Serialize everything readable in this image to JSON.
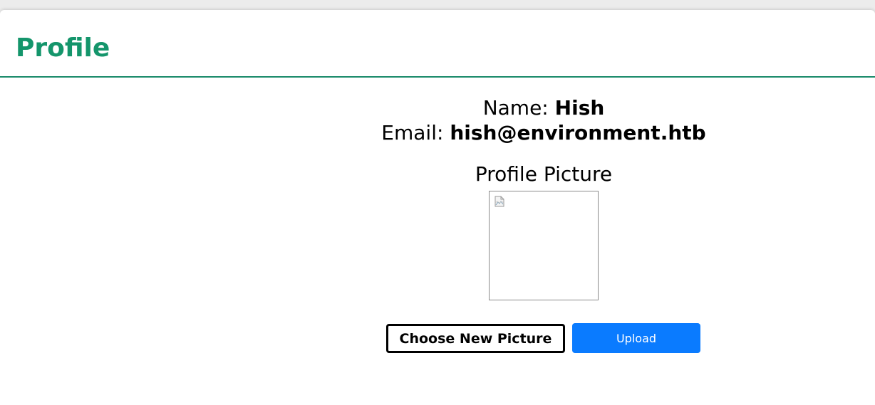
{
  "header": {
    "title": "Profile"
  },
  "profile": {
    "name_label": "Name:",
    "name_value": "Hish",
    "email_label": "Email:",
    "email_value": "hish@environment.htb"
  },
  "picture": {
    "title": "Profile Picture",
    "image_state": "broken-image-icon"
  },
  "actions": {
    "choose_label": "Choose New Picture",
    "upload_label": "Upload"
  },
  "colors": {
    "title_green": "#14956b",
    "header_rule": "#1a8a6a",
    "upload_blue": "#0a7bff"
  }
}
